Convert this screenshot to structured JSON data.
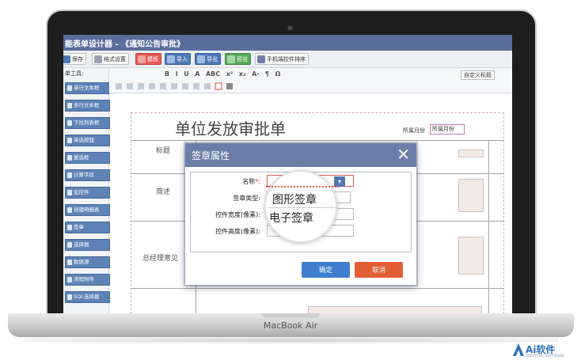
{
  "app": {
    "title": "能表单设计器 - 《通知公告审批》"
  },
  "toolbar": {
    "save": "保存",
    "format_settings": "格式设置",
    "template": "模板",
    "import": "导入",
    "export": "导出",
    "preview": "预览",
    "mobile_sort": "手机端控件排序"
  },
  "editor_toolbar": {
    "row1_glyphs": [
      "B",
      "I",
      "U",
      "A",
      "ABC",
      "x²",
      "x₂",
      "A·",
      "¶",
      "Ω"
    ],
    "custom_title": "自定义标题"
  },
  "control_panel": {
    "title": "单工具:",
    "items": [
      "单行文本框",
      "多行文本框",
      "下拉列表框",
      "单选按钮",
      "复选框",
      "计算字段",
      "宏控件",
      "创建明细表",
      "签章",
      "选择器",
      "数据源",
      "流程附件",
      "SQL选择器"
    ]
  },
  "form": {
    "title": "单位发放审批单",
    "month_label": "所属月份",
    "month_value": "所属月份",
    "row_labels": [
      "标题",
      "简述",
      "总经理意见"
    ]
  },
  "dialog": {
    "title": "签章属性",
    "close": "✕",
    "fields": {
      "name_label": "名称",
      "name_required": "*:",
      "stamp_type_label": "签章类型:",
      "width_label": "控件宽度(像素):",
      "height_label": "控件高度(像素):"
    },
    "confirm": "确定",
    "cancel": "取消"
  },
  "dropdown_zoom": {
    "options": [
      "图形签章",
      "电子签章"
    ]
  },
  "device": {
    "label": "MacBook Air"
  },
  "watermark": {
    "text": "Ai软件",
    "subtext": "AIKUSOHE SOFTWARE"
  },
  "colors": {
    "accent_blue": "#5a6e9c",
    "dialog_header": "#6c7ea8",
    "confirm_blue": "#3d7fcc",
    "cancel_orange": "#e15e35"
  }
}
